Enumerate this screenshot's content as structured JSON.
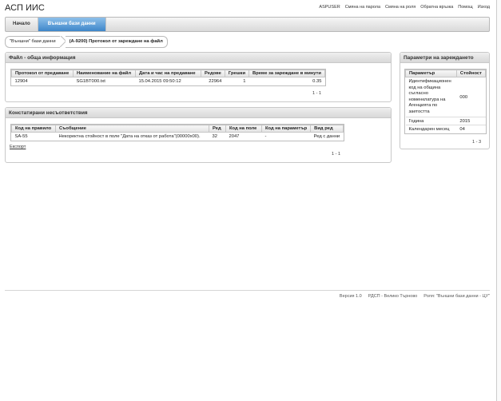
{
  "app": {
    "title": "АСП ИИС"
  },
  "toplinks": [
    "ASPUSER",
    "Смяна на парола",
    "Смяна на роля",
    "Обратна връзка",
    "Помощ",
    "Изход"
  ],
  "nav": {
    "tabs": [
      {
        "label": "Начало"
      },
      {
        "label": "Външни бази данни"
      }
    ]
  },
  "breadcrumb": {
    "items": [
      "\"Външни\" бази данни",
      "(А-9200) Протокол от зареждане на файл"
    ]
  },
  "file_panel": {
    "title": "Файл - обща информация",
    "columns": [
      "Протокол от предаване",
      "Наименование на файл",
      "Дата и час на предаване",
      "Редове",
      "Грешки",
      "Време за зареждане в минути"
    ],
    "rows": [
      [
        "12904",
        "SG1BT000.txt",
        "15.04.2015 09:50:12",
        "22964",
        "1",
        "0.35"
      ]
    ],
    "pager": "1 - 1"
  },
  "errors_panel": {
    "title": "Констатирани несъответствия",
    "columns": [
      "Код на правило",
      "Съобщение",
      "Ред",
      "Код на поле",
      "Код на параметър",
      "Вид ред"
    ],
    "rows": [
      [
        "SA-55",
        "Некоректна стойност в поле \"Дата на отказ от работа\"(00000x00).",
        "32",
        "2047",
        "-",
        "Ред с данни"
      ]
    ],
    "export": "Експорт",
    "pager": "1 - 1"
  },
  "params_panel": {
    "title": "Параметри на зареждането",
    "columns": [
      "Параметър",
      "Стойност"
    ],
    "rows": [
      [
        "Идентификационен код на община съгласно номенклатура на Агенцията по заетостта",
        "000"
      ],
      [
        "Година",
        "2015"
      ],
      [
        "Календарен месец",
        "04"
      ]
    ],
    "pager": "1 - 3"
  },
  "footer": {
    "version": "Версия 1.0",
    "office": "РДСП - Велико Търново",
    "role": "Роля: \"Външни бази данни - ЦУ\""
  }
}
